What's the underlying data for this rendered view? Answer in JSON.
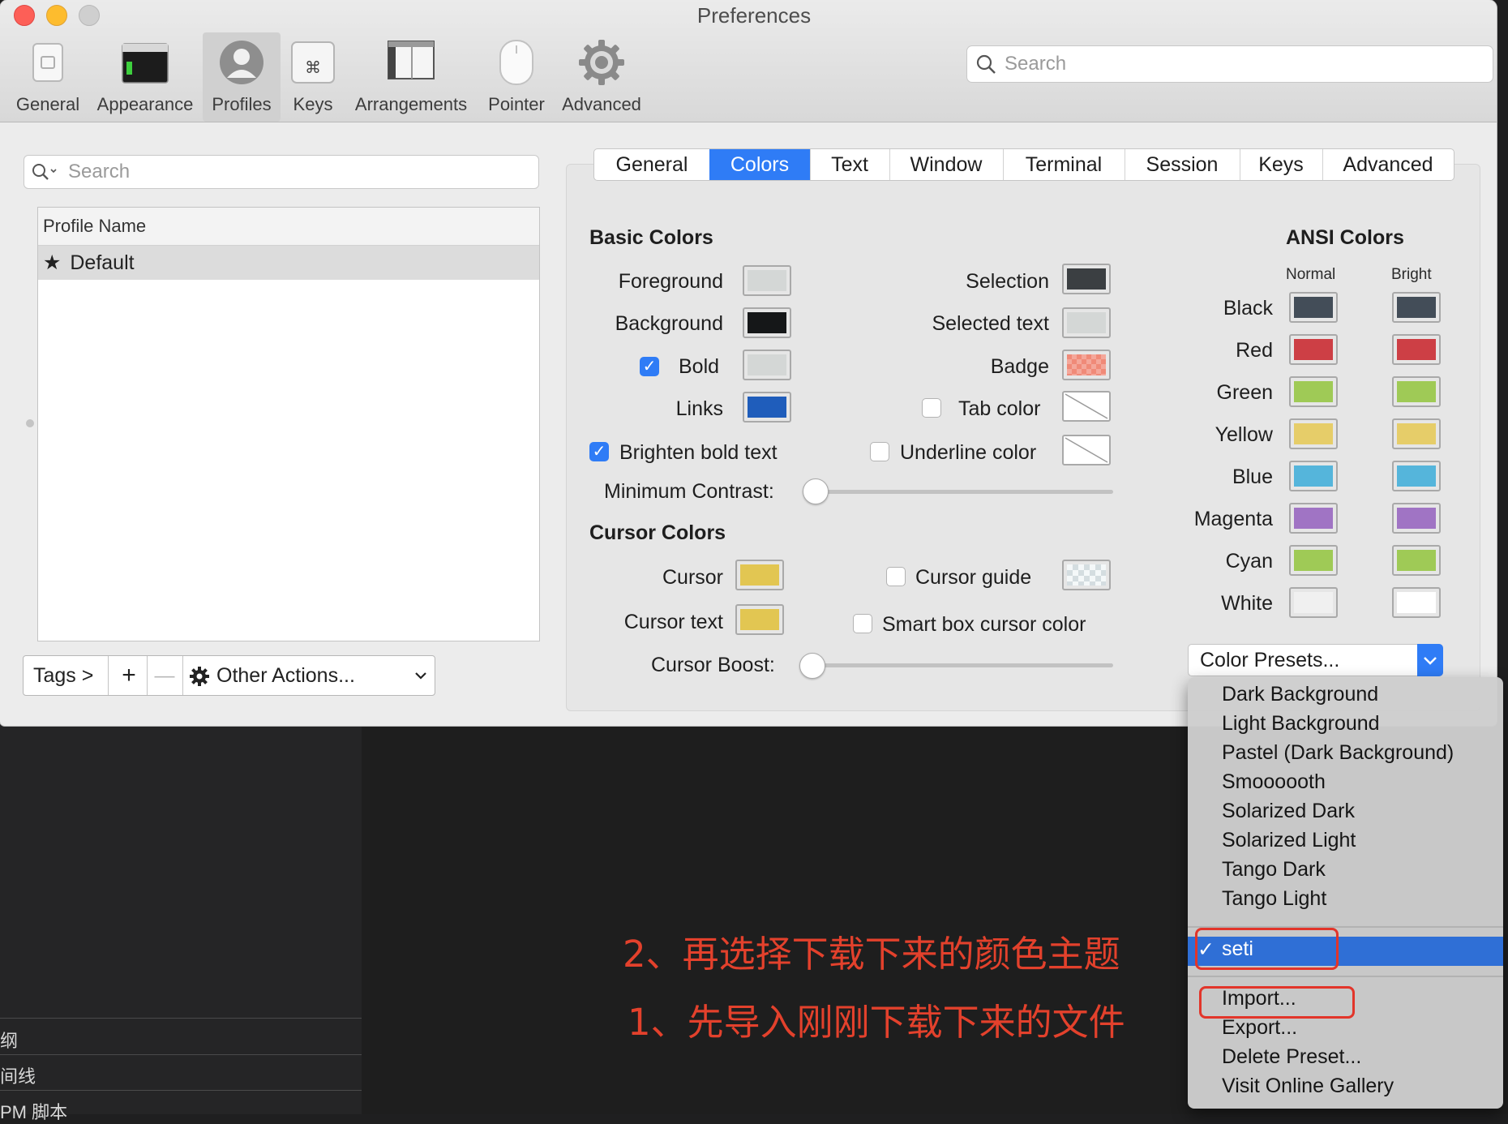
{
  "window": {
    "title": "Preferences"
  },
  "toolbar": {
    "items": [
      {
        "label": "General",
        "icon": "general-icon"
      },
      {
        "label": "Appearance",
        "icon": "appearance-icon"
      },
      {
        "label": "Profiles",
        "icon": "profiles-icon",
        "selected": true
      },
      {
        "label": "Keys",
        "icon": "command-key-icon"
      },
      {
        "label": "Arrangements",
        "icon": "arrangements-icon"
      },
      {
        "label": "Pointer",
        "icon": "mouse-icon"
      },
      {
        "label": "Advanced",
        "icon": "gear-icon"
      }
    ],
    "search_placeholder": "Search"
  },
  "profiles": {
    "search_placeholder": "Search",
    "column_header": "Profile Name",
    "rows": [
      "Default"
    ],
    "tags_label": "Tags >",
    "add_symbol": "+",
    "remove_symbol": "—",
    "other_actions": "Other Actions..."
  },
  "tabs": [
    "General",
    "Colors",
    "Text",
    "Window",
    "Terminal",
    "Session",
    "Keys",
    "Advanced"
  ],
  "selected_tab": "Colors",
  "basic_colors": {
    "title": "Basic Colors",
    "foreground": {
      "label": "Foreground",
      "color": "#d4d7d6"
    },
    "background": {
      "label": "Background",
      "color": "#151718"
    },
    "bold": {
      "label": "Bold",
      "color": "#d4d7d6",
      "checked": true
    },
    "links": {
      "label": "Links",
      "color": "#1f5dbb"
    },
    "selection": {
      "label": "Selection",
      "color": "#3b3f42"
    },
    "selected_text": {
      "label": "Selected text",
      "color": "#d4d7d6"
    },
    "badge": {
      "label": "Badge",
      "color": "#f08a78"
    },
    "tab_color": {
      "label": "Tab color",
      "checked": false
    },
    "underline_color": {
      "label": "Underline color",
      "checked": false
    },
    "brighten_bold": {
      "label": "Brighten bold text",
      "checked": true
    },
    "min_contrast": {
      "label": "Minimum Contrast:",
      "value": 0
    }
  },
  "cursor_colors": {
    "title": "Cursor Colors",
    "cursor": {
      "label": "Cursor",
      "color": "#e2c652"
    },
    "cursor_text": {
      "label": "Cursor text",
      "color": "#e2c652"
    },
    "cursor_guide": {
      "label": "Cursor guide",
      "checked": false
    },
    "smart_box": {
      "label": "Smart box cursor color",
      "checked": false
    },
    "cursor_boost": {
      "label": "Cursor Boost:",
      "value": 0
    }
  },
  "ansi": {
    "title": "ANSI Colors",
    "normal_label": "Normal",
    "bright_label": "Bright",
    "rows": [
      {
        "name": "Black",
        "normal": "#434d58",
        "bright": "#434d58"
      },
      {
        "name": "Red",
        "normal": "#cd3f45",
        "bright": "#cd3f45"
      },
      {
        "name": "Green",
        "normal": "#9fca56",
        "bright": "#9fca56"
      },
      {
        "name": "Yellow",
        "normal": "#e6cd69",
        "bright": "#e6cd69"
      },
      {
        "name": "Blue",
        "normal": "#55b5db",
        "bright": "#55b5db"
      },
      {
        "name": "Magenta",
        "normal": "#a074c4",
        "bright": "#a074c4"
      },
      {
        "name": "Cyan",
        "normal": "#9fca56",
        "bright": "#9fca56"
      },
      {
        "name": "White",
        "normal": "#f0f0f0",
        "bright": "#ffffff"
      }
    ]
  },
  "presets": {
    "button_label": "Color Presets...",
    "menu_group1": [
      "Dark Background",
      "Light Background",
      "Pastel (Dark Background)",
      "Smoooooth",
      "Solarized Dark",
      "Solarized Light",
      "Tango Dark",
      "Tango Light"
    ],
    "selected": "seti",
    "menu_group2": [
      "Import...",
      "Export...",
      "Delete Preset...",
      "Visit Online Gallery"
    ]
  },
  "annotations": {
    "step2": "2、再选择下载下来的颜色主题",
    "step1": "1、先导入刚刚下载下来的文件"
  },
  "background_sidebar": [
    "纲",
    "间线",
    "PM 脚本"
  ]
}
